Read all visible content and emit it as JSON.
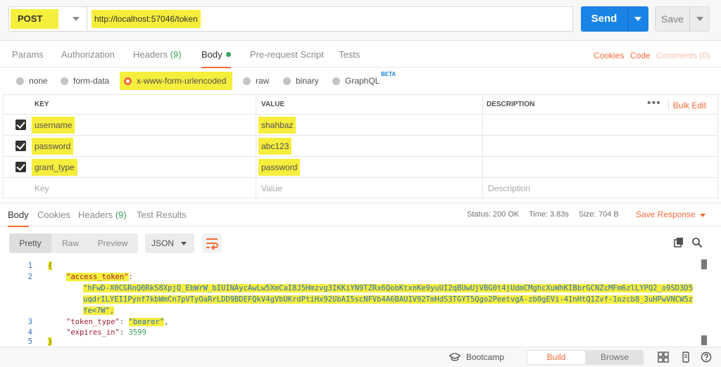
{
  "request": {
    "method": "POST",
    "url": "http://localhost:57046/token",
    "send_label": "Send",
    "save_label": "Save"
  },
  "request_tabs": {
    "params": "Params",
    "authorization": "Authorization",
    "headers": "Headers",
    "headers_count": "(9)",
    "body": "Body",
    "prerequest": "Pre-request Script",
    "tests": "Tests",
    "cookies": "Cookies",
    "code": "Code",
    "comments": "Comments (0)"
  },
  "body_types": {
    "none": "none",
    "form_data": "form-data",
    "urlencoded": "x-www-form-urlencoded",
    "raw": "raw",
    "binary": "binary",
    "graphql": "GraphQL",
    "beta": "BETA",
    "selected": "x-www-form-urlencoded"
  },
  "kv_table": {
    "headers": {
      "key": "KEY",
      "value": "VALUE",
      "description": "DESCRIPTION"
    },
    "bulk_edit": "Bulk Edit",
    "more": "•••",
    "rows": [
      {
        "checked": true,
        "key": "username",
        "value": "shahbaz"
      },
      {
        "checked": true,
        "key": "password",
        "value": "abc123"
      },
      {
        "checked": true,
        "key": "grant_type",
        "value": "password"
      }
    ],
    "placeholder": {
      "key": "Key",
      "value": "Value",
      "description": "Description"
    }
  },
  "response_tabs": {
    "body": "Body",
    "cookies": "Cookies",
    "headers": "Headers",
    "headers_count": "(9)",
    "test_results": "Test Results"
  },
  "response_meta": {
    "status_label": "Status:",
    "status_value": "200 OK",
    "time_label": "Time:",
    "time_value": "3.83s",
    "size_label": "Size:",
    "size_value": "704 B",
    "save_response": "Save Response"
  },
  "viewer": {
    "pretty": "Pretty",
    "raw": "Raw",
    "preview": "Preview",
    "format": "JSON"
  },
  "code": {
    "line_numbers": [
      "1",
      "2",
      "3",
      "4",
      "5"
    ],
    "open_brace": "{",
    "close_brace": "}",
    "access_token_key": "\"access_token\"",
    "access_token_line1": "\"hFwD-X0CGRnQ0RkS8XpjQ_EbWrW_bIUINAycAwLw5XmCaI8J5Hmzvg3IKKiYN9TZRx6QobKtxnKe9yuUI2qBUwUjVBG0t4jUdmCMghcXuWhKIBbrGCNZcMFm6zlLYPQ2_o9SD3D5",
    "access_token_line2": "uqdrILYEI1Pynf7kbWmCn7pVTyOaRrLDD9BDEFQkV4gVbUKrdPtiHx92UbAI5scNFVb4A6BAUIV92TmHdS3TGYT5Qgo2PeetvgA-zb0gEVi-41nHtQ1Zvf-1ozcb8_3uHPwVNCW5z",
    "access_token_line3": "fe<7W\",",
    "token_type_key": "\"token_type\"",
    "token_type_value": "\"bearer\"",
    "expires_in_key": "\"expires_in\"",
    "expires_in_value": "3599"
  },
  "footer": {
    "bootcamp": "Bootcamp",
    "build": "Build",
    "browse": "Browse"
  },
  "colors": {
    "accent": "#f26b3a",
    "send_blue": "#1a83e6",
    "success_green": "#3aa15d",
    "highlight": "#f6ee3c"
  }
}
